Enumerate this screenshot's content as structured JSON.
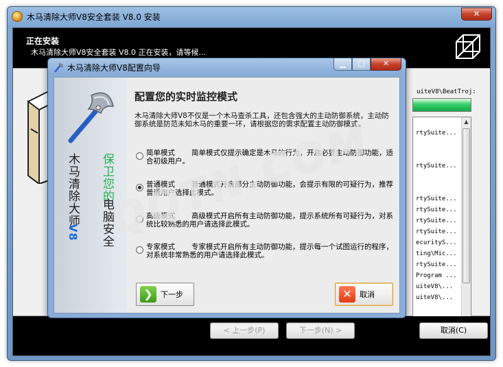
{
  "outer_window": {
    "title": "木马清除大师V8安全套装 V8.0 安装",
    "close_glyph": "✕"
  },
  "header": {
    "title": "正在安装",
    "subtitle": "木马清除大师V8安全套装 V8.0 正在安装，请等候..."
  },
  "install_area": {
    "path_text": "uiteV8\\BeatTroj:",
    "progress_percent": 100,
    "log_lines": [
      "",
      "rtySuite...",
      "",
      "",
      "rtySuite...",
      "",
      "",
      "rtySuite...",
      "rtySuite...",
      "rtySuite...",
      "rtySuite...",
      "ecurityS...",
      "ting\\Mic...",
      "rtySuite...",
      "Program ...",
      "uiteV8\\...",
      "uiteV8\\..."
    ]
  },
  "footer": {
    "back_label": "< 上一步(P)",
    "next_label": "下一步(N) >",
    "cancel_label": "取消(C)"
  },
  "dialog": {
    "title": "木马清除大师V8配置向导",
    "minimize_glyph": "▁",
    "maximize_glyph": "□",
    "close_glyph": "✕",
    "banner_name": "木马清除大师",
    "banner_version": "V8",
    "banner_slogan_1": "保卫您的",
    "banner_slogan_2": "电脑安全",
    "heading": "配置您的实时监控模式",
    "description": "木马清除大师V8不仅是一个木马查杀工具，还包含强大的主动防御系统，主动防御系统是防范未知木马的重要一环，请根据您的需求配置主动防御模式。",
    "watermark": "QQTN.COM",
    "options": [
      {
        "name": "简单模式",
        "text": "简单模式仅提示确定是木马的行为，开启必要主动防御功能，适合初级用户。",
        "checked": false
      },
      {
        "name": "普通模式",
        "text": "普通模式开启部分主动防御功能，会提示有限的可疑行为，推荐普通用户选择此模式。",
        "checked": true
      },
      {
        "name": "高级模式",
        "text": "高级模式开启所有主动防御功能，提示系统所有可疑行为，对系统比较熟悉的用户请选择此模式。",
        "checked": false
      },
      {
        "name": "专家模式",
        "text": "专家模式开启所有主动防御功能，提示每一个试图运行的程序，对系统非常熟悉的用户请选择此模式。",
        "checked": false
      }
    ],
    "next_label": "下一步",
    "next_icon_glyph": "❯",
    "cancel_label": "取消",
    "cancel_icon_glyph": "✕"
  }
}
